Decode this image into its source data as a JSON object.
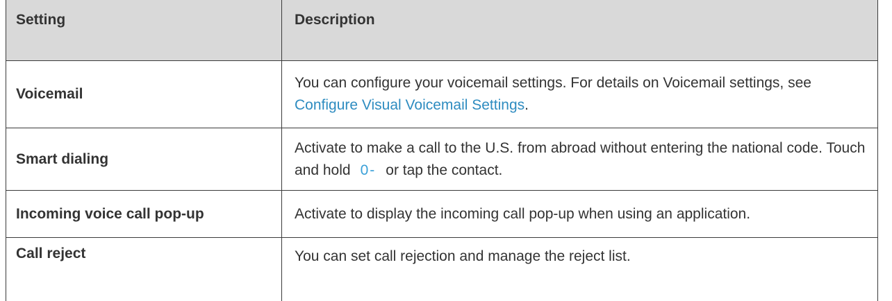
{
  "table": {
    "headers": [
      "Setting",
      "Description"
    ],
    "rows": [
      {
        "setting": "Voicemail",
        "desc_before": "You can configure your voicemail settings. For details on Voicemail settings, see ",
        "desc_link": "Configure Visual Voicemail Settings",
        "desc_after": "."
      },
      {
        "setting": "Smart dialing",
        "desc_before": "Activate to make a call to the U.S. from abroad without entering the national code. Touch and hold",
        "key_icon": "0-",
        "desc_after": "or tap the contact."
      },
      {
        "setting": "Incoming voice call pop-up",
        "desc": "Activate to display the incoming call pop-up when using an application."
      },
      {
        "setting": "Call reject",
        "desc": "You can set call rejection and manage the reject list."
      }
    ]
  },
  "colors": {
    "header_bg": "#d9d9d9",
    "link": "#2e8cc0",
    "text": "#333333"
  }
}
